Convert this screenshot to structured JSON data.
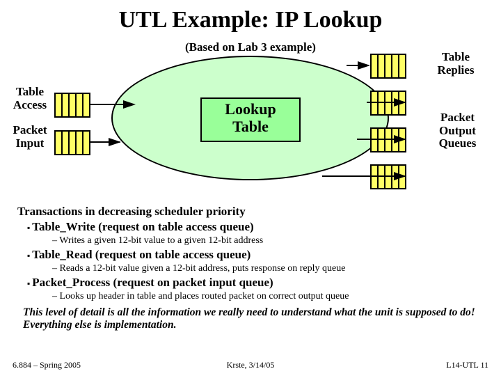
{
  "title": "UTL Example: IP Lookup",
  "subtitle": "(Based on Lab 3 example)",
  "labels": {
    "table_access": "Table\nAccess",
    "packet_input": "Packet\nInput",
    "table_replies": "Table\nReplies",
    "packet_output": "Packet\nOutput\nQueues",
    "lookup_table": "Lookup\nTable"
  },
  "body": {
    "heading": "Transactions in decreasing scheduler priority",
    "items": [
      {
        "name": "Table_Write (request on table access queue)",
        "detail": "Writes a given 12-bit value to a given 12-bit address"
      },
      {
        "name": "Table_Read (request on table access queue)",
        "detail": "Reads a 12-bit value given a 12-bit address, puts response on reply queue"
      },
      {
        "name": "Packet_Process (request on packet input queue)",
        "detail": "Looks up header in table and places routed packet on correct output queue"
      }
    ],
    "summary": "This level of detail is all the information we really need to understand what the unit is supposed to do!  Everything else is implementation."
  },
  "footer": {
    "left": "6.884 – Spring 2005",
    "center": "Krste, 3/14/05",
    "right": "L14-UTL 11"
  }
}
